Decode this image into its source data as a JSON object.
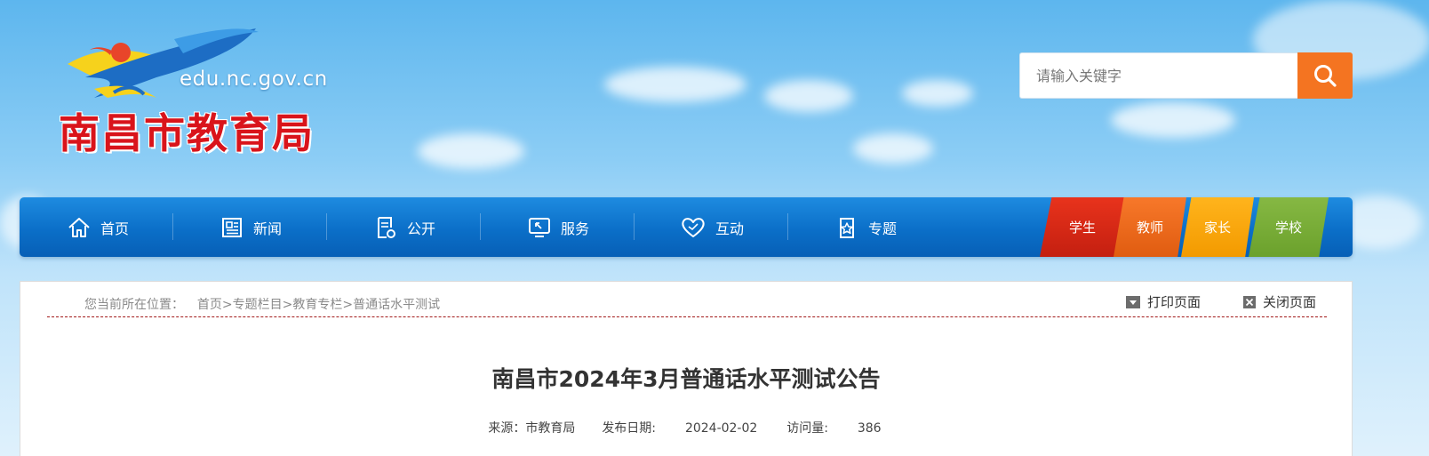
{
  "header": {
    "logo": {
      "domain": "edu.nc.gov.cn",
      "name": "南昌市教育局"
    },
    "search": {
      "placeholder": "请输入关键字",
      "button_icon": "search-icon"
    }
  },
  "nav": {
    "items": [
      {
        "label": "首页",
        "icon": "home-icon"
      },
      {
        "label": "新闻",
        "icon": "newspaper-icon"
      },
      {
        "label": "公开",
        "icon": "document-icon"
      },
      {
        "label": "服务",
        "icon": "monitor-icon"
      },
      {
        "label": "互动",
        "icon": "heart-icon"
      },
      {
        "label": "专题",
        "icon": "star-document-icon"
      }
    ],
    "tags": [
      {
        "label": "学生",
        "color": "#d72a16"
      },
      {
        "label": "教师",
        "color": "#f06a1e"
      },
      {
        "label": "家长",
        "color": "#fbab10"
      },
      {
        "label": "学校",
        "color": "#7aae38"
      }
    ]
  },
  "breadcrumb": {
    "prefix": "您当前所在位置：",
    "items": [
      "首页",
      "专题栏目",
      "教育专栏",
      "普通话水平测试"
    ],
    "separator": ">"
  },
  "tools": {
    "print": "打印页面",
    "close": "关闭页面"
  },
  "article": {
    "title": "南昌市2024年3月普通话水平测试公告",
    "source_label": "来源：",
    "source": "市教育局",
    "date_label": "发布日期:",
    "date": "2024-02-02",
    "views_label": "访问量:",
    "views": "386"
  },
  "colors": {
    "nav_blue": "#0b6fc8",
    "search_orange": "#f47421",
    "logo_red": "#d9141b",
    "divider_red": "#a31b1b"
  }
}
